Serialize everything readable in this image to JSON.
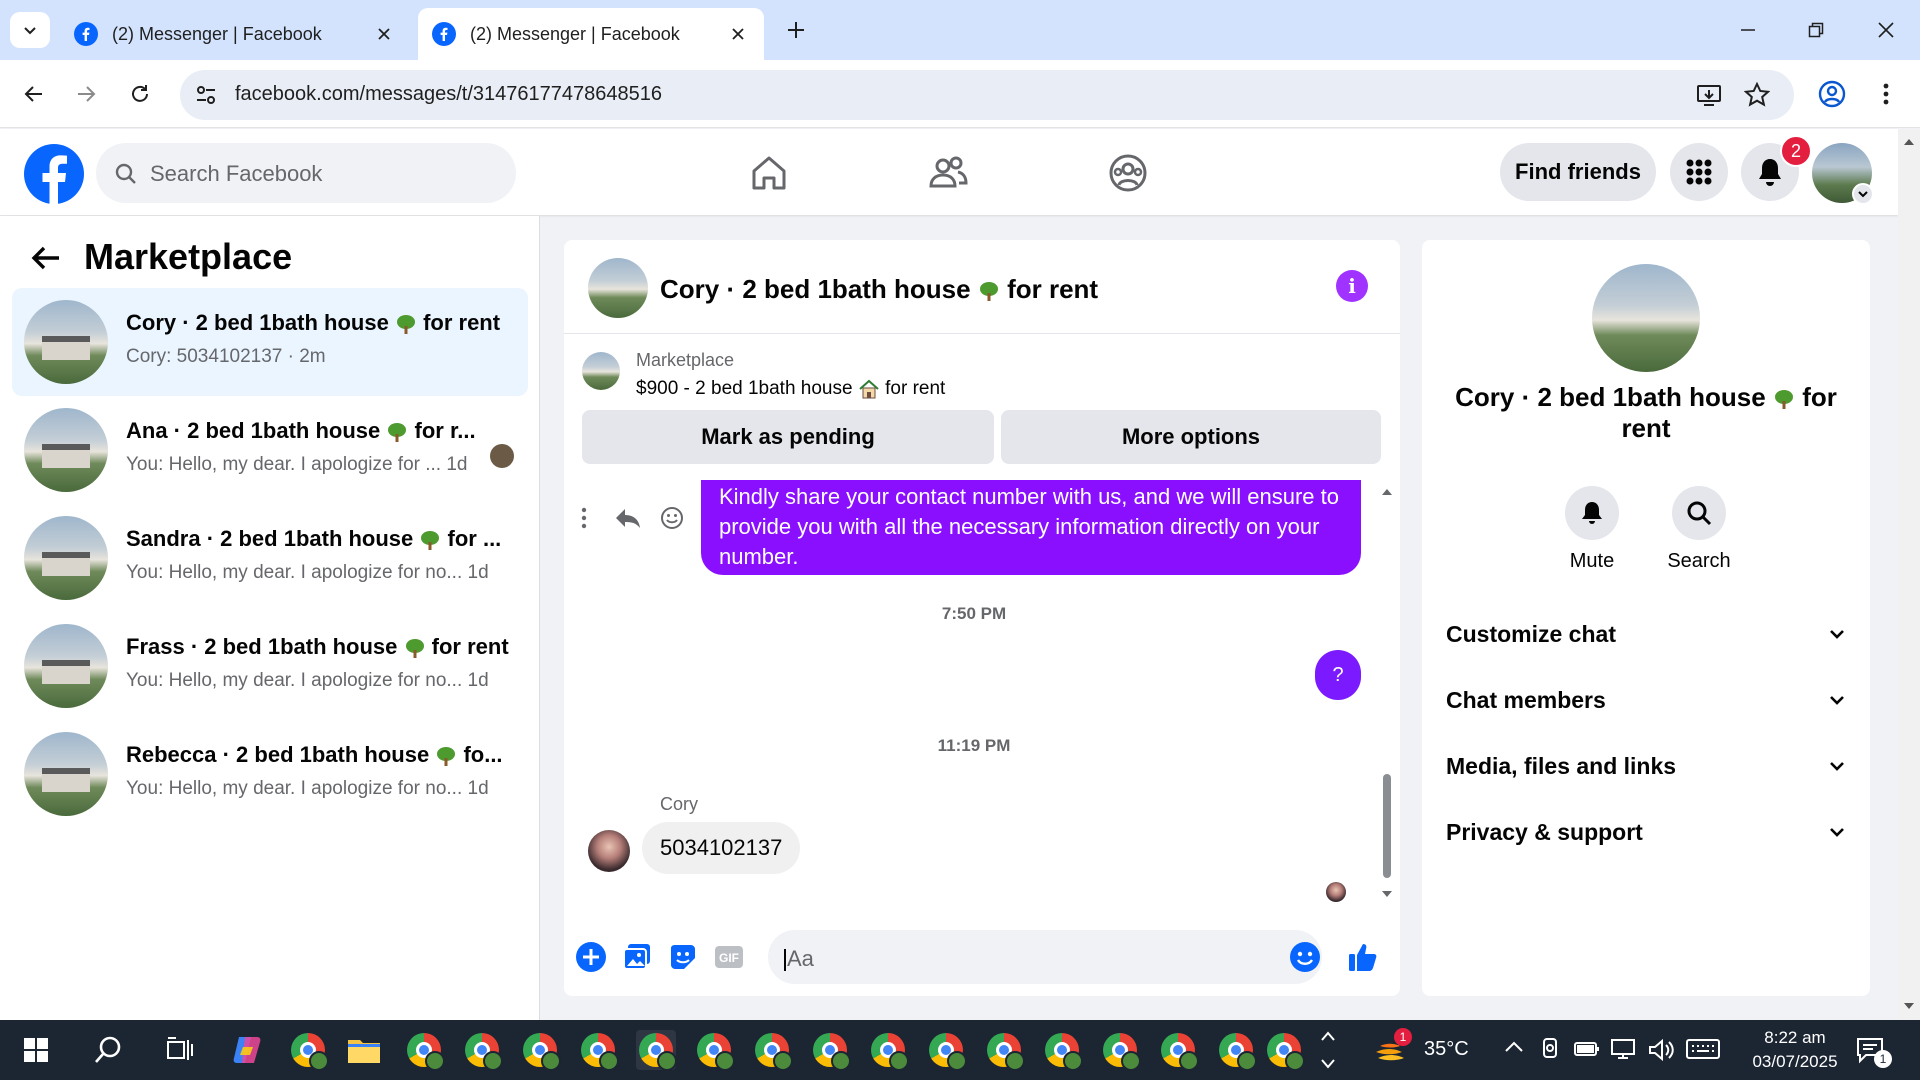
{
  "browser": {
    "tabs": [
      {
        "title": "(2) Messenger | Facebook",
        "active": false
      },
      {
        "title": "(2) Messenger | Facebook",
        "active": true
      }
    ],
    "url": "facebook.com/messages/t/31476177478648516"
  },
  "fb_header": {
    "search_placeholder": "Search Facebook",
    "find_friends_label": "Find friends",
    "notification_count": "2"
  },
  "left_panel": {
    "title": "Marketplace",
    "conversations": [
      {
        "name": "Cory · 2 bed 1bath house",
        "name_suffix": " for rent",
        "preview": "Cory: 5034102137 · 2m",
        "active": true
      },
      {
        "name": "Ana · 2 bed 1bath house",
        "name_suffix": " for r...",
        "preview": "You: Hello, my dear. I apologize for ... 1d",
        "active": false
      },
      {
        "name": "Sandra · 2 bed 1bath house",
        "name_suffix": " for ...",
        "preview": "You: Hello, my dear. I apologize for no... 1d",
        "active": false
      },
      {
        "name": "Frass · 2 bed 1bath house",
        "name_suffix": " for rent",
        "preview": "You: Hello, my dear. I apologize for no... 1d",
        "active": false
      },
      {
        "name": "Rebecca · 2 bed 1bath house",
        "name_suffix": " fo...",
        "preview": "You: Hello, my dear. I apologize for no... 1d",
        "active": false
      }
    ]
  },
  "chat": {
    "title": "Cory · 2 bed 1bath house",
    "title_suffix": " for rent",
    "info_glyph": "i",
    "marketplace_label": "Marketplace",
    "listing_price": "$900 - 2 bed 1bath house",
    "listing_suffix": " for rent",
    "mark_pending_label": "Mark as pending",
    "more_options_label": "More options",
    "outgoing_message": "Kindly share your contact number with us, and we will ensure to provide you with all the necessary information directly on your number.",
    "timestamp_1": "7:50 PM",
    "question_bubble": "?",
    "timestamp_2": "11:19 PM",
    "sender_name": "Cory",
    "incoming_message": "5034102137",
    "input_placeholder": "Aa"
  },
  "right_panel": {
    "name": "Cory · 2 bed 1bath house",
    "name_suffix": " for rent",
    "mute_label": "Mute",
    "search_label": "Search",
    "sections": [
      "Customize chat",
      "Chat members",
      "Media, files and links",
      "Privacy & support"
    ]
  },
  "taskbar": {
    "weather_badge": "1",
    "temperature": "35°C",
    "time": "8:22 am",
    "date": "03/07/2025",
    "notification_badge": "1"
  },
  "colors": {
    "fb_blue": "#0866ff",
    "messenger_purple": "#8a0fff",
    "active_conv_bg": "#ebf5ff"
  }
}
